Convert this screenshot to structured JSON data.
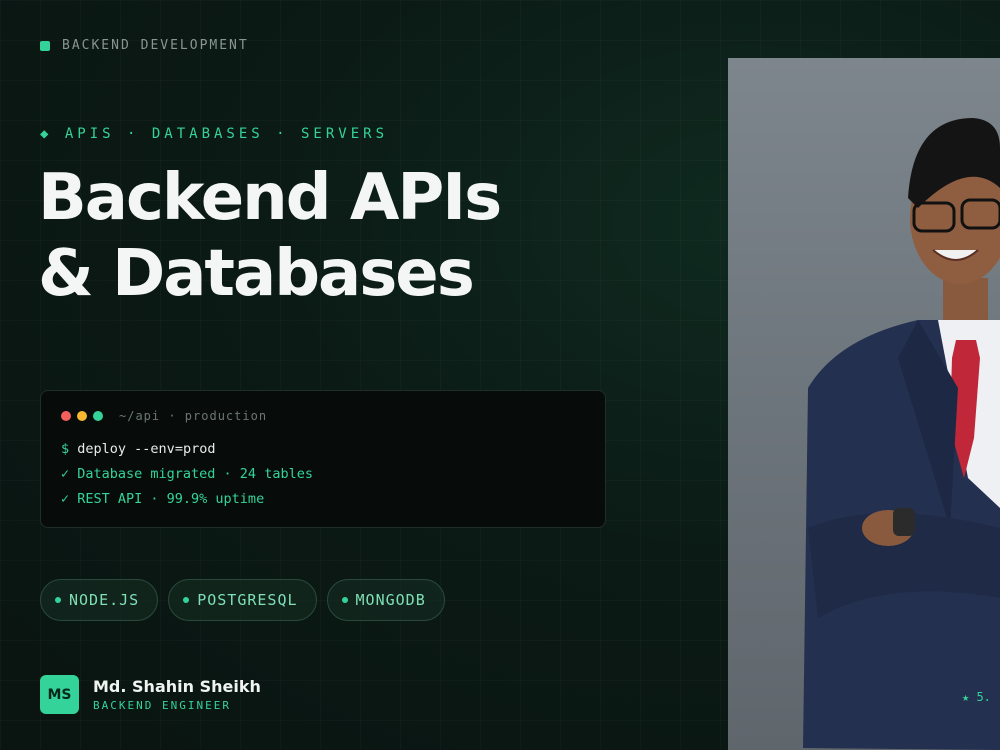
{
  "header": {
    "label": "BACKEND DEVELOPMENT"
  },
  "hero": {
    "tagline": "◆ APIS · DATABASES · SERVERS",
    "title_line1": "Backend APIs",
    "title_line2": "& Databases"
  },
  "terminal": {
    "path": "~/api · production",
    "prompt": "$",
    "command": "deploy --env=prod",
    "lines": [
      "✓ Database migrated · 24 tables",
      "✓ REST API · 99.9% uptime"
    ]
  },
  "tags": [
    "NODE.JS",
    "POSTGRESQL",
    "MONGODB"
  ],
  "author": {
    "initials": "MS",
    "name": "Md. Shahin Sheikh",
    "role": "BACKEND ENGINEER"
  },
  "rating": "★ 5.",
  "colors": {
    "accent": "#34d399",
    "background": "#0b1a15",
    "dot_red": "#f25f5c",
    "dot_yellow": "#f7b731",
    "dot_green": "#34d399"
  },
  "photo": {
    "alt": "Smiling man in glasses, navy suit and red tie, arms crossed"
  }
}
